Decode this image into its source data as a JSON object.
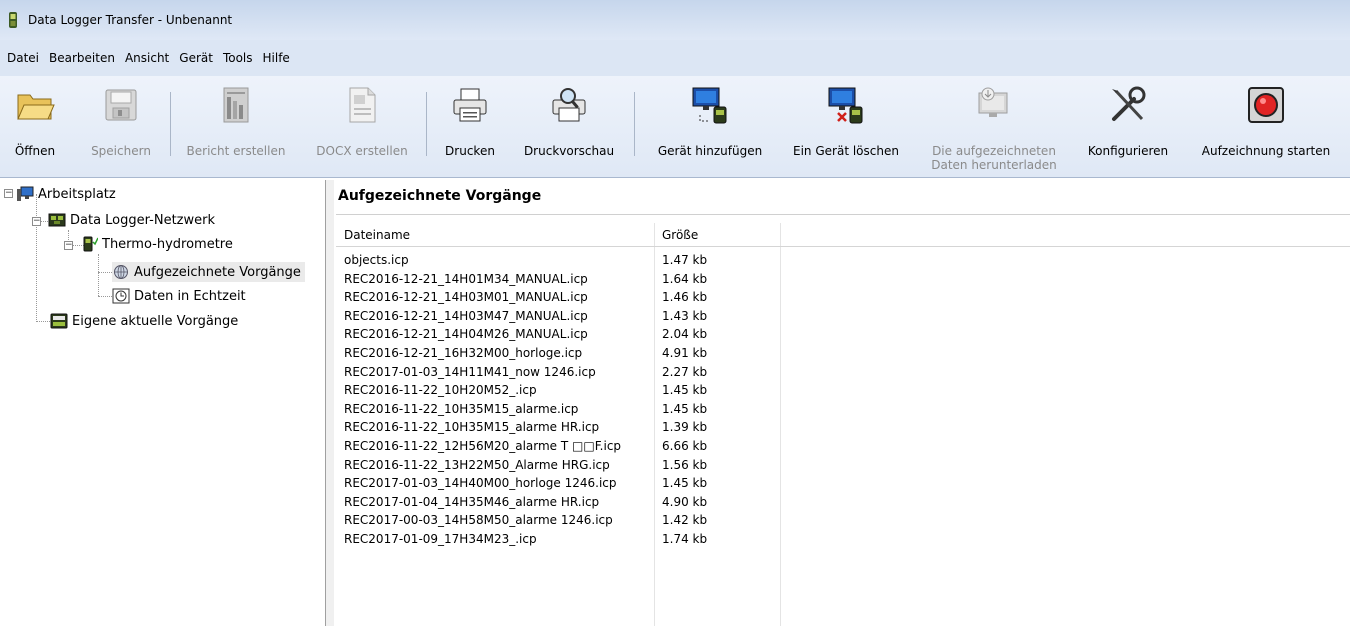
{
  "window": {
    "title": "Data Logger Transfer - Unbenannt"
  },
  "menu": [
    "Datei",
    "Bearbeiten",
    "Ansicht",
    "Gerät",
    "Tools",
    "Hilfe"
  ],
  "toolbar": {
    "open": "Öffnen",
    "save": "Speichern",
    "report": "Bericht erstellen",
    "docx": "DOCX erstellen",
    "print": "Drucken",
    "preview": "Druckvorschau",
    "add_device": "Gerät hinzufügen",
    "delete_device": "Ein Gerät löschen",
    "download_line1": "Die aufgezeichneten",
    "download_line2": "Daten herunterladen",
    "configure": "Konfigurieren",
    "start_recording": "Aufzeichnung starten"
  },
  "tree": {
    "root": "Arbeitsplatz",
    "network": "Data Logger-Netzwerk",
    "device": "Thermo-hydrometre",
    "recorded": "Aufgezeichnete Vorgänge",
    "realtime": "Daten in Echtzeit",
    "own": "Eigene aktuelle Vorgänge"
  },
  "main": {
    "title": "Aufgezeichnete Vorgänge",
    "columns": [
      "Dateiname",
      "Größe"
    ],
    "rows": [
      [
        "objects.icp",
        "1.47 kb"
      ],
      [
        "REC2016-12-21_14H01M34_MANUAL.icp",
        "1.64 kb"
      ],
      [
        "REC2016-12-21_14H03M01_MANUAL.icp",
        "1.46 kb"
      ],
      [
        "REC2016-12-21_14H03M47_MANUAL.icp",
        "1.43 kb"
      ],
      [
        "REC2016-12-21_14H04M26_MANUAL.icp",
        "2.04 kb"
      ],
      [
        "REC2016-12-21_16H32M00_horloge.icp",
        "4.91 kb"
      ],
      [
        "REC2017-01-03_14H11M41_now 1246.icp",
        "2.27 kb"
      ],
      [
        "REC2016-11-22_10H20M52_.icp",
        "1.45 kb"
      ],
      [
        "REC2016-11-22_10H35M15_alarme.icp",
        "1.45 kb"
      ],
      [
        "REC2016-11-22_10H35M15_alarme HR.icp",
        "1.39 kb"
      ],
      [
        "REC2016-11-22_12H56M20_alarme T □□F.icp",
        "6.66 kb"
      ],
      [
        "REC2016-11-22_13H22M50_Alarme HRG.icp",
        "1.56 kb"
      ],
      [
        "REC2017-01-03_14H40M00_horloge 1246.icp",
        "1.45 kb"
      ],
      [
        "REC2017-01-04_14H35M46_alarme HR.icp",
        "4.90 kb"
      ],
      [
        "REC2017-00-03_14H58M50_alarme 1246.icp",
        "1.42 kb"
      ],
      [
        "REC2017-01-09_17H34M23_.icp",
        "1.74 kb"
      ]
    ]
  },
  "colors": {
    "titlebar": "#c6d6ec",
    "menubar": "#dce6f4",
    "toolbar": "#e6edf8"
  },
  "icons": [
    "app-icon",
    "folder-open-icon",
    "floppy-disk-icon",
    "report-icon",
    "docx-icon",
    "printer-icon",
    "print-preview-icon",
    "add-device-icon",
    "delete-device-icon",
    "download-icon",
    "tools-icon",
    "record-icon",
    "computer-icon",
    "network-icon",
    "thermo-device-icon",
    "globe-icon",
    "clock-icon",
    "display-icon"
  ]
}
